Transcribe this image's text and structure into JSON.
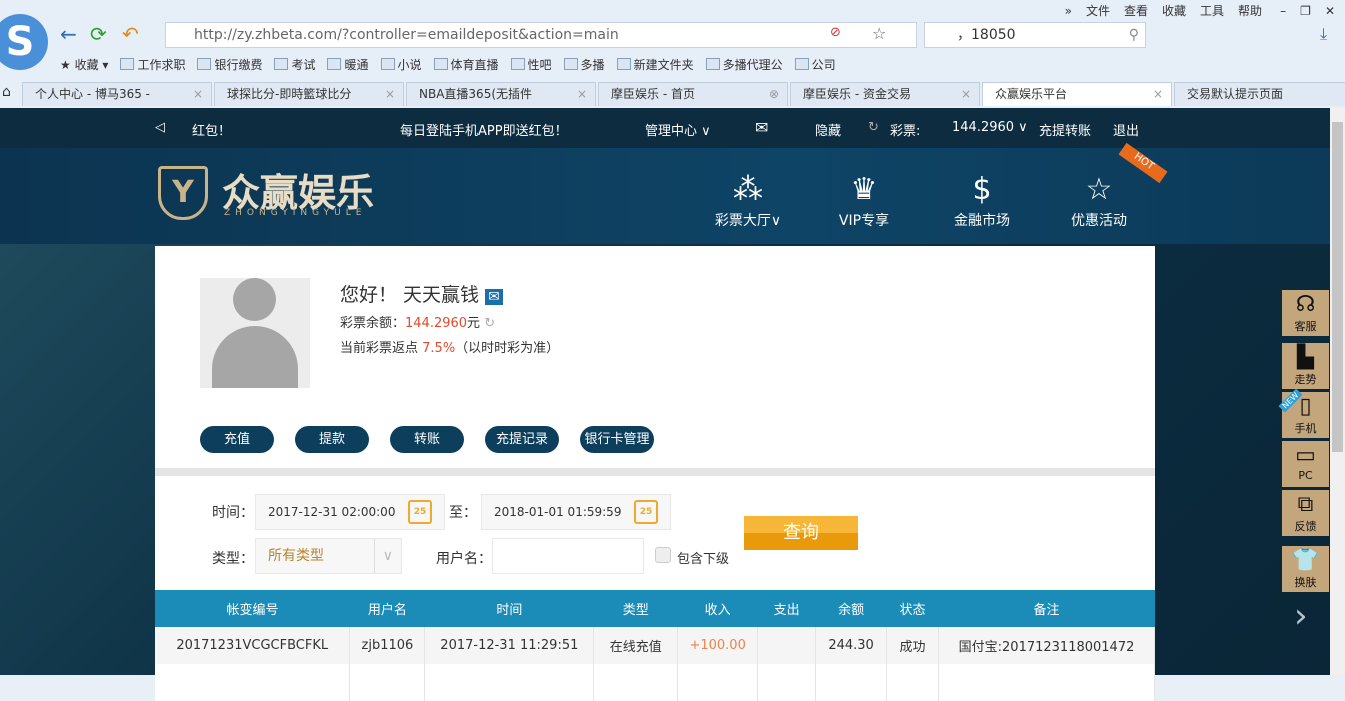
{
  "browser": {
    "menu": [
      "»",
      "文件",
      "查看",
      "收藏",
      "工具",
      "帮助"
    ],
    "url": "http://zy.zhbeta.com/?controller=emaildeposit&action=main",
    "search_value": "，18050",
    "bookmarks": [
      "收藏",
      "工作求职",
      "银行缴费",
      "考试",
      "暖通",
      "小说",
      "体育直播",
      "性吧",
      "多播",
      "新建文件夹",
      "多播代理公",
      "公司"
    ],
    "tabs": [
      {
        "label": "个人中心 - 博马365 - "
      },
      {
        "label": "球探比分-即時籃球比分"
      },
      {
        "label": "NBA直播365(无插件"
      },
      {
        "label": "摩臣娱乐 - 首页"
      },
      {
        "label": "摩臣娱乐 - 资金交易"
      },
      {
        "label": "众赢娱乐平台"
      },
      {
        "label": "交易默认提示页面"
      }
    ]
  },
  "topbar": {
    "marquee": "红包！",
    "notice": "每日登陆手机APP即送红包！",
    "manage": "管理中心 ∨",
    "hide": "隐藏",
    "lottery_label": "彩票:",
    "balance": "144.2960 ∨",
    "deposit_withdraw": "充提转账",
    "logout": "退出"
  },
  "header": {
    "logo_cn": "众赢娱乐",
    "logo_en": "ZHONGYINGYULE",
    "nav": [
      {
        "label": "彩票大厅∨",
        "icon": "⁂"
      },
      {
        "label": "VIP专享",
        "icon": "♛"
      },
      {
        "label": "金融市场",
        "icon": "$"
      },
      {
        "label": "优惠活动",
        "icon": "☆"
      }
    ],
    "hot": "HOT"
  },
  "profile": {
    "greeting": "您好！ 天天赢钱",
    "balance_label": "彩票余额：",
    "balance": "144.2960",
    "balance_unit": "元",
    "rebate_label": "当前彩票返点 ",
    "rebate": "7.5%",
    "rebate_note": "（以时时彩为准）"
  },
  "actions": [
    "充值",
    "提款",
    "转账",
    "充提记录",
    "银行卡管理"
  ],
  "filter": {
    "time_label": "时间：",
    "start": "2017-12-31 02:00:00",
    "to_label": "至：",
    "end": "2018-01-01 01:59:59",
    "cal_day": "25",
    "type_label": "类型：",
    "type_value": "所有类型",
    "user_label": "用户名：",
    "user_value": "",
    "include_sub": "包含下级",
    "query": "查询"
  },
  "table": {
    "headers": [
      "帐变编号",
      "用户名",
      "时间",
      "类型",
      "收入",
      "支出",
      "余额",
      "状态",
      "备注"
    ],
    "rows": [
      [
        "20171231VCGCFBCFKL",
        "zjb1106",
        "2017-12-31 11:29:51",
        "在线充值",
        "+100.00",
        "",
        "244.30",
        "成功",
        "国付宝:2017123118001472"
      ]
    ]
  },
  "sidebar": [
    "客服",
    "走势",
    "手机",
    "PC",
    "反馈",
    "换肤"
  ],
  "sidebar_new": "NEW"
}
